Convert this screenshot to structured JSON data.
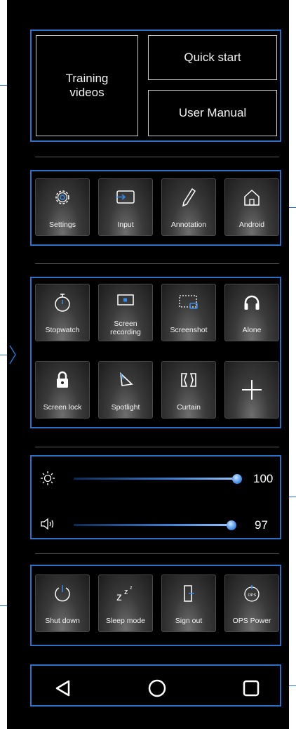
{
  "top": {
    "training_videos": "Training\nvideos",
    "quick_start": "Quick start",
    "user_manual": "User Manual"
  },
  "row1": [
    {
      "label": "Settings",
      "icon": "gear-icon"
    },
    {
      "label": "Input",
      "icon": "input-icon"
    },
    {
      "label": "Annotation",
      "icon": "pencil-icon"
    },
    {
      "label": "Android",
      "icon": "home-icon"
    }
  ],
  "tools": [
    {
      "label": "Stopwatch",
      "icon": "stopwatch-icon"
    },
    {
      "label": "Screen\nrecording",
      "icon": "screen-recording-icon"
    },
    {
      "label": "Screenshot",
      "icon": "screenshot-icon"
    },
    {
      "label": "Alone",
      "icon": "headphones-icon"
    },
    {
      "label": "Screen lock",
      "icon": "lock-icon"
    },
    {
      "label": "Spotlight",
      "icon": "spotlight-icon"
    },
    {
      "label": "Curtain",
      "icon": "curtain-icon"
    },
    {
      "label": "",
      "icon": "plus-icon"
    }
  ],
  "sliders": {
    "brightness": {
      "value": "100",
      "icon": "brightness-icon"
    },
    "volume": {
      "value": "97",
      "icon": "volume-icon"
    }
  },
  "power": [
    {
      "label": "Shut down",
      "icon": "power-icon"
    },
    {
      "label": "Sleep mode",
      "icon": "sleep-icon"
    },
    {
      "label": "Sign out",
      "icon": "sign-out-icon"
    },
    {
      "label": "OPS Power",
      "icon": "ops-power-icon"
    }
  ],
  "nav": {
    "back": "back-icon",
    "home": "home-circle-icon",
    "recents": "recents-icon"
  },
  "colors": {
    "accent": "#2f6fc4",
    "background": "#000000"
  }
}
